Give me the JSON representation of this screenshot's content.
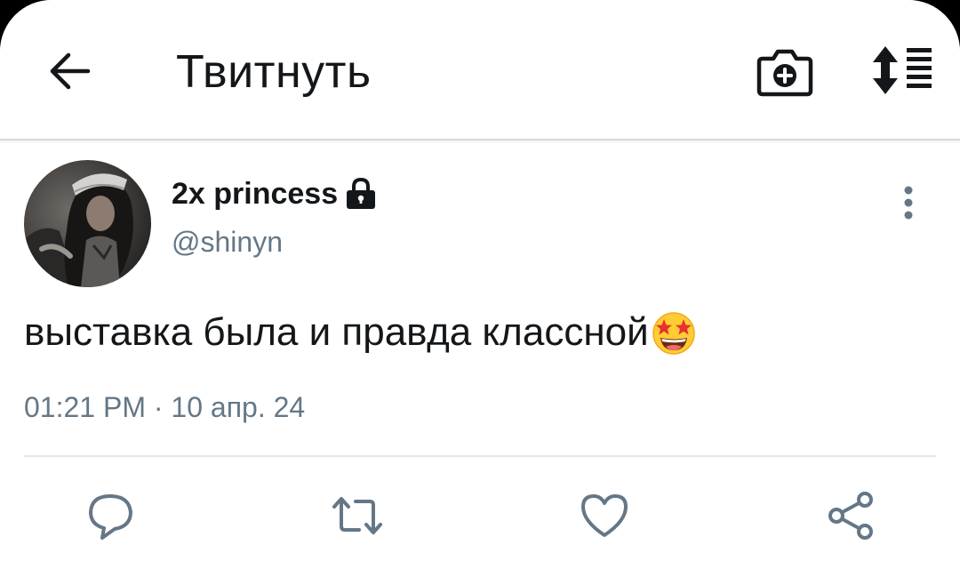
{
  "header": {
    "title": "Твитнуть",
    "back_icon": "arrow-left-icon",
    "camera_icon": "camera-plus-icon",
    "sort_icon": "sort-list-icon"
  },
  "tweet": {
    "display_name": "2x princess",
    "protected_icon": "lock-icon",
    "handle": "@shinyn",
    "text": "выставка была и правда классной",
    "emoji": "star-struck-emoji",
    "time": "01:21 PM",
    "separator": " · ",
    "date": "10 апр. 24"
  },
  "actions": [
    {
      "name": "reply",
      "icon": "comment-icon"
    },
    {
      "name": "retweet",
      "icon": "retweet-icon"
    },
    {
      "name": "like",
      "icon": "heart-icon"
    },
    {
      "name": "share",
      "icon": "share-icon"
    }
  ],
  "colors": {
    "text_primary": "#14171a",
    "text_secondary": "#657786",
    "icon_gray": "#657786",
    "divider": "#e1e8ed"
  }
}
